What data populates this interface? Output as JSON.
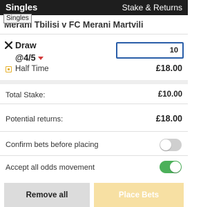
{
  "header": {
    "title": "Singles",
    "right_label": "Stake & Returns"
  },
  "tooltip": "Singles",
  "event": "Merani Tbilisi v FC Merani Martvili",
  "selection": {
    "name": "Draw",
    "odds": "@4/5",
    "odds_trend_color": "#d33b3b",
    "stake_value": "10",
    "market": "Half Time",
    "returns": "£18.00"
  },
  "summary": {
    "total_stake_label": "Total Stake:",
    "total_stake_value": "£10.00",
    "potential_returns_label": "Potential returns:",
    "potential_returns_value": "£18.00"
  },
  "settings": {
    "confirm_label": "Confirm bets before placing",
    "confirm_enabled": false,
    "accept_label": "Accept all odds movement",
    "accept_enabled": true
  },
  "buttons": {
    "remove_all": "Remove all",
    "place_bets": "Place Bets"
  },
  "colors": {
    "header": "#1e1e1e",
    "stake_border": "#2a5ea8",
    "toggle_on": "#4cb05a",
    "place_bets": "#f7e0a3"
  }
}
